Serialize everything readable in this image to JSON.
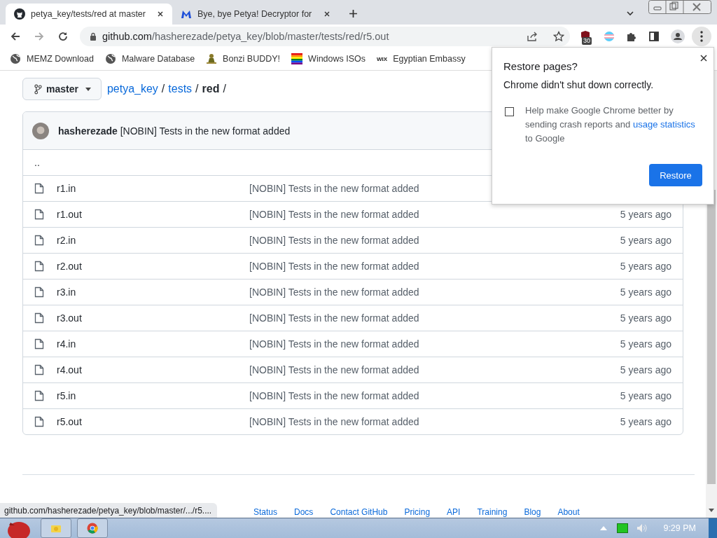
{
  "tabs": [
    {
      "title": "petya_key/tests/red at master",
      "selected": true
    },
    {
      "title": "Bye, bye Petya! Decryptor for",
      "selected": false
    }
  ],
  "address": {
    "host": "github.com",
    "path": "/hasherezade/petya_key/blob/master/tests/red/r5.out"
  },
  "extension_badge": "30",
  "bookmarks": [
    {
      "label": "MEMZ Download"
    },
    {
      "label": "Malware Database"
    },
    {
      "label": "Bonzi BUDDY!"
    },
    {
      "label": "Windows ISOs"
    },
    {
      "label": "Egyptian Embassy",
      "logo_text": "WIX"
    }
  ],
  "branch": "master",
  "breadcrumb": [
    {
      "label": "petya_key",
      "kind": "link"
    },
    {
      "label": "/",
      "kind": "separator"
    },
    {
      "label": "tests",
      "kind": "link"
    },
    {
      "label": "/",
      "kind": "separator"
    },
    {
      "label": "red",
      "kind": "current"
    },
    {
      "label": "/",
      "kind": "separator"
    }
  ],
  "commit": {
    "author": "hasherezade",
    "message": "[NOBIN] Tests in the new format added"
  },
  "parent_dir": "..",
  "files": [
    {
      "name": "r1.in",
      "message": "[NOBIN] Tests in the new format added"
    },
    {
      "name": "r1.out",
      "message": "[NOBIN] Tests in the new format added",
      "age": "5 years ago"
    },
    {
      "name": "r2.in",
      "message": "[NOBIN] Tests in the new format added",
      "age": "5 years ago"
    },
    {
      "name": "r2.out",
      "message": "[NOBIN] Tests in the new format added",
      "age": "5 years ago"
    },
    {
      "name": "r3.in",
      "message": "[NOBIN] Tests in the new format added",
      "age": "5 years ago"
    },
    {
      "name": "r3.out",
      "message": "[NOBIN] Tests in the new format added",
      "age": "5 years ago"
    },
    {
      "name": "r4.in",
      "message": "[NOBIN] Tests in the new format added",
      "age": "5 years ago"
    },
    {
      "name": "r4.out",
      "message": "[NOBIN] Tests in the new format added",
      "age": "5 years ago"
    },
    {
      "name": "r5.in",
      "message": "[NOBIN] Tests in the new format added",
      "age": "5 years ago"
    },
    {
      "name": "r5.out",
      "message": "[NOBIN] Tests in the new format added",
      "age": "5 years ago"
    }
  ],
  "footer_links": [
    "Status",
    "Docs",
    "Contact GitHub",
    "Pricing",
    "API",
    "Training",
    "Blog",
    "About"
  ],
  "status_url": "github.com/hasherezade/petya_key/blob/master/.../r5....",
  "restore_popup": {
    "title": "Restore pages?",
    "message": "Chrome didn't shut down correctly.",
    "checkbox": {
      "checked": false,
      "text": "Help make Google Chrome better by sending crash reports and",
      "link": "usage statistics",
      "text_after": "to Google"
    },
    "button": "Restore"
  },
  "clock": "9:29 PM"
}
